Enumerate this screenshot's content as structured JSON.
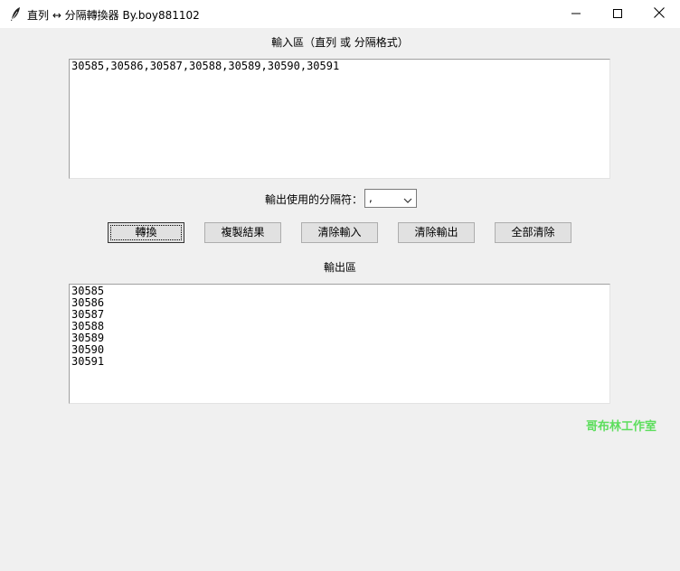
{
  "window": {
    "title": "直列 ↔ 分隔轉換器 By.boy881102",
    "icon": "feather-icon",
    "controls": [
      "minimize-icon",
      "maximize-icon",
      "close-icon"
    ]
  },
  "input_section": {
    "label": "輸入區（直列 或 分隔格式）",
    "value": "30585,30586,30587,30588,30589,30590,30591"
  },
  "separator": {
    "label": "輸出使用的分隔符：",
    "selected": ","
  },
  "buttons": {
    "convert": "轉換",
    "copy": "複製結果",
    "clear_input": "清除輸入",
    "clear_output": "清除輸出",
    "clear_all": "全部清除"
  },
  "output_section": {
    "label": "輸出區",
    "value": "30585\n30586\n30587\n30588\n30589\n30590\n30591"
  },
  "watermark": {
    "text": "哥布林工作室",
    "color": "#5dde5d"
  }
}
